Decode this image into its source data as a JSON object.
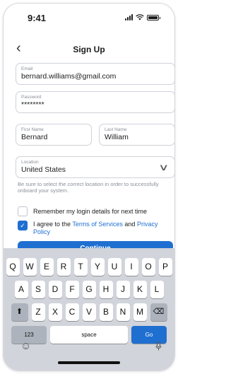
{
  "status": {
    "time": "9:41"
  },
  "header": {
    "title": "Sign Up",
    "back_icon": "chevron-left-icon"
  },
  "form": {
    "email": {
      "label": "Email",
      "value": "bernard.williams@gmail.com"
    },
    "password": {
      "label": "Password",
      "value": "********"
    },
    "first_name": {
      "label": "First Name",
      "value": "Bernard"
    },
    "last_name": {
      "label": "Last Name",
      "value": "William"
    },
    "location": {
      "label": "Location",
      "value": "United States"
    },
    "location_hint": "Be sure to select the correct location in order to successfully onboard your system.",
    "remember": {
      "label": "Remember my login details for next time",
      "checked": false
    },
    "agree": {
      "prefix": "I agree to the ",
      "terms_link": "Terms of Services",
      "joiner": " and ",
      "privacy_link": "Privacy Policy",
      "checked": true
    },
    "continue_label": "Continue"
  },
  "keyboard": {
    "row1": [
      "Q",
      "W",
      "E",
      "R",
      "T",
      "Y",
      "U",
      "I",
      "O",
      "P"
    ],
    "row2": [
      "A",
      "S",
      "D",
      "F",
      "G",
      "H",
      "J",
      "K",
      "L"
    ],
    "row3": [
      "Z",
      "X",
      "C",
      "V",
      "B",
      "N",
      "M"
    ],
    "numbers_label": "123",
    "space_label": "space",
    "go_label": "Go"
  },
  "colors": {
    "accent": "#1f6fd1",
    "keyboard_bg": "#d1d4da"
  }
}
